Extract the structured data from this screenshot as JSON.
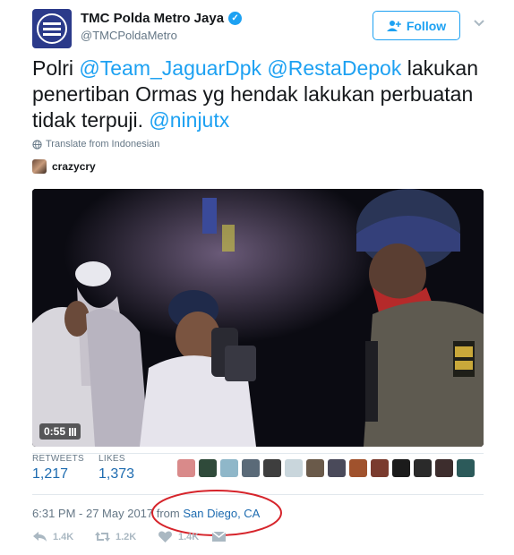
{
  "account": {
    "name": "TMC Polda Metro Jaya",
    "handle": "@TMCPoldaMetro",
    "verified": true
  },
  "follow_button": {
    "label": "Follow"
  },
  "tweet": {
    "prefix": "Polri ",
    "mention1": "@Team_JaguarDpk",
    "between": " ",
    "mention2": "@RestaDepok",
    "body": " lakukan penertiban Ormas yg hendak lakukan perbuatan tidak terpuji.  ",
    "mention3": "@ninjutx"
  },
  "translate": {
    "label": "Translate from Indonesian"
  },
  "media_credit": {
    "name": "crazycry"
  },
  "video": {
    "duration": "0:55"
  },
  "stats": {
    "retweets_label": "RETWEETS",
    "retweets_value": "1,217",
    "likes_label": "LIKES",
    "likes_value": "1,373"
  },
  "likers": [
    "#d98a8a",
    "#2f4a3a",
    "#8fb7c9",
    "#5a6a78",
    "#3e3e3e",
    "#c9d6dc",
    "#6a5a4a",
    "#4a4a5a",
    "#a0522d",
    "#7a3b2e",
    "#1b1b1b",
    "#2a2a2a",
    "#3d2d2d",
    "#2c5a5a"
  ],
  "timestamp": {
    "text": "6:31 PM - 27 May 2017 from ",
    "location": "San Diego, CA"
  },
  "actions": {
    "reply_count": "1.4K",
    "retweet_count": "1.2K",
    "like_count": "1.4K"
  },
  "colors": {
    "accent": "#1da1f2",
    "link": "#1d6bb0",
    "annotation": "#d6242b"
  }
}
